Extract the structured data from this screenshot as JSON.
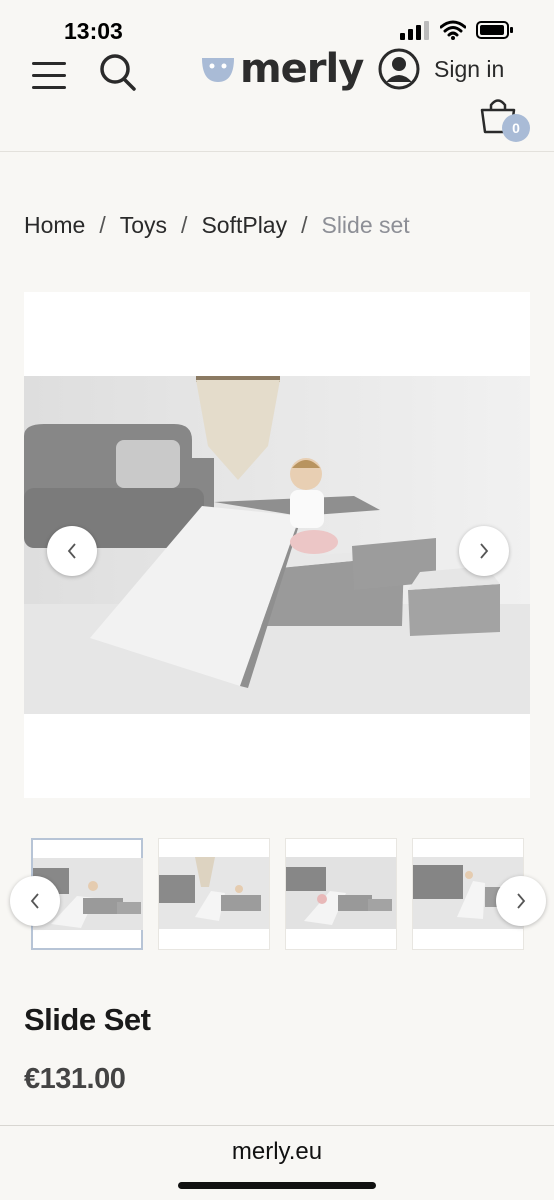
{
  "status": {
    "time": "13:03"
  },
  "header": {
    "logo_text": "merly",
    "signin_label": "Sign in",
    "cart_count": "0"
  },
  "breadcrumb": {
    "items": [
      "Home",
      "Toys",
      "SoftPlay"
    ],
    "current": "Slide set",
    "separator": "/"
  },
  "product": {
    "title": "Slide Set",
    "price": "€131.00"
  },
  "gallery": {
    "thumbnails": 4,
    "active_index": 0
  },
  "browser": {
    "url": "merly.eu"
  },
  "colors": {
    "background": "#f8f7f4",
    "badge": "#a9bbd6",
    "breadcrumb_current": "#8d8f96",
    "slide_gray": "#8f8f8f"
  }
}
